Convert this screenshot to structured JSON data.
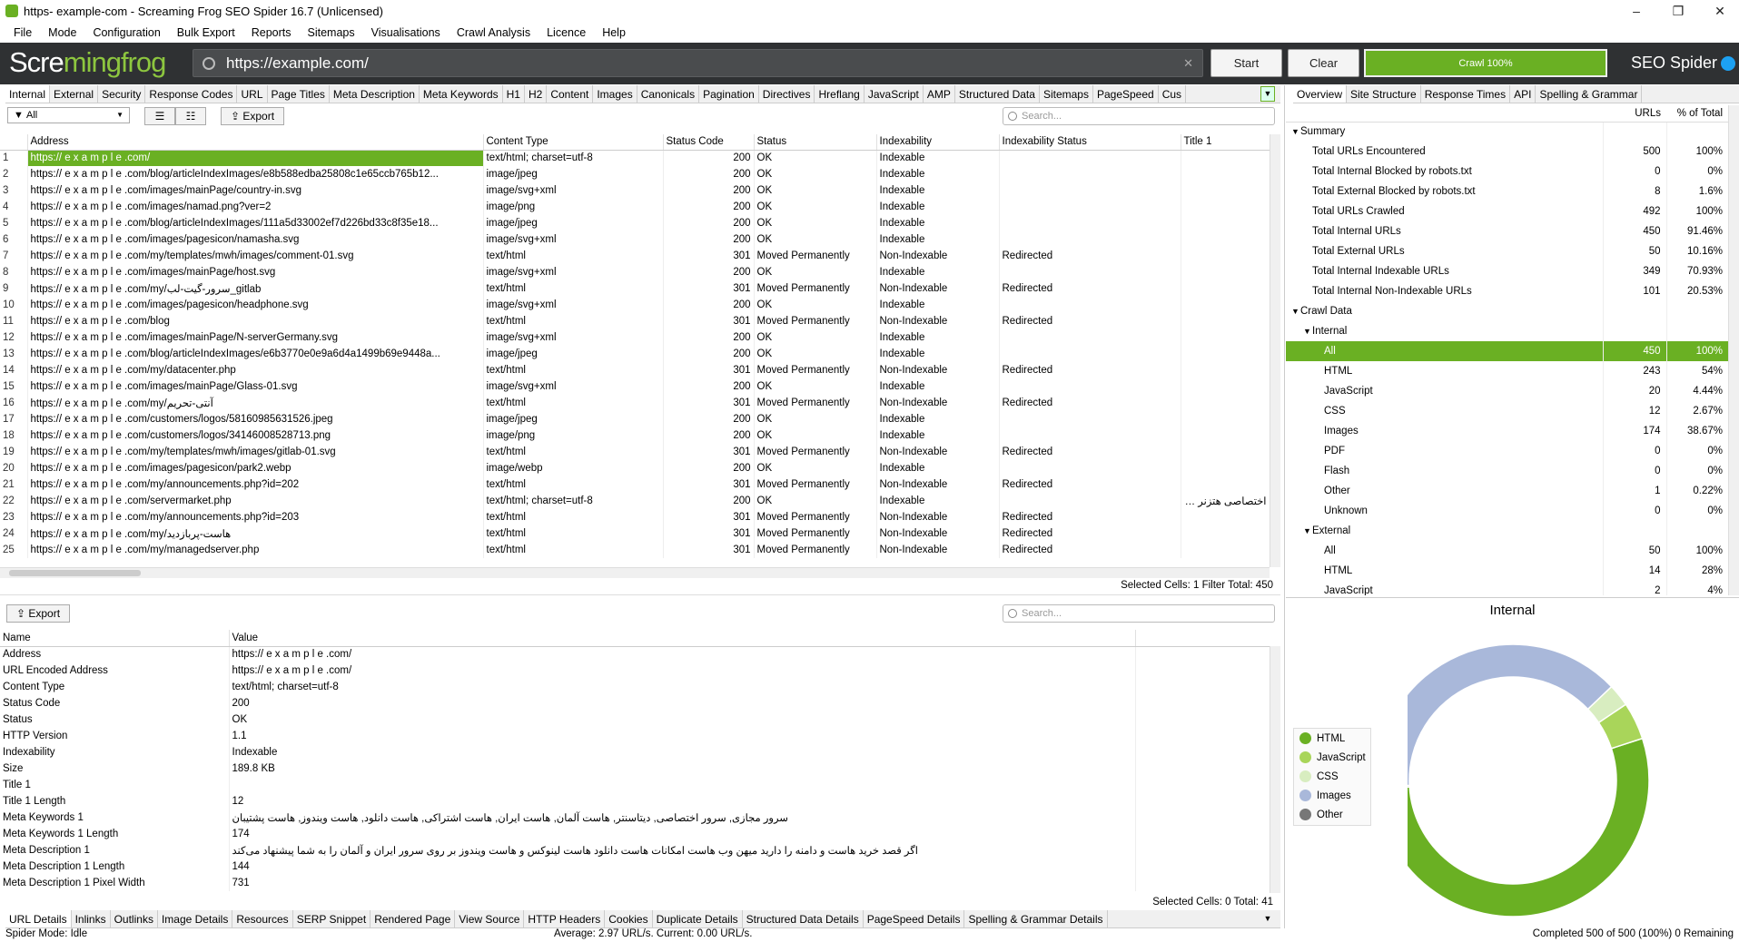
{
  "window": {
    "title": "https- example-com - Screaming Frog SEO Spider 16.7 (Unlicensed)"
  },
  "menu": [
    "File",
    "Mode",
    "Configuration",
    "Bulk Export",
    "Reports",
    "Sitemaps",
    "Visualisations",
    "Crawl Analysis",
    "Licence",
    "Help"
  ],
  "toolbar": {
    "logo_a": "Scre",
    "logo_b": "mingfrog",
    "url": "https://example.com/",
    "start": "Start",
    "clear": "Clear",
    "progress": "Crawl 100%",
    "brand": "SEO Spider"
  },
  "tabs": [
    "Internal",
    "External",
    "Security",
    "Response Codes",
    "URL",
    "Page Titles",
    "Meta Description",
    "Meta Keywords",
    "H1",
    "H2",
    "Content",
    "Images",
    "Canonicals",
    "Pagination",
    "Directives",
    "Hreflang",
    "JavaScript",
    "AMP",
    "Structured Data",
    "Sitemaps",
    "PageSpeed",
    "Cus"
  ],
  "filter": {
    "value": "All",
    "export": "Export",
    "search_placeholder": "Search..."
  },
  "columns": [
    "Address",
    "Content Type",
    "Status Code",
    "Status",
    "Indexability",
    "Indexability Status",
    "Title 1"
  ],
  "rows": [
    [
      "1",
      "https:// e x a m p l e .com/",
      "text/html; charset=utf-8",
      "200",
      "OK",
      "Indexable",
      "",
      ""
    ],
    [
      "2",
      "https:// e x a m p l e .com/blog/articleIndexImages/e8b588edba25808c1e65ccb765b12...",
      "image/jpeg",
      "200",
      "OK",
      "Indexable",
      "",
      ""
    ],
    [
      "3",
      "https:// e x a m p l e .com/images/mainPage/country-in.svg",
      "image/svg+xml",
      "200",
      "OK",
      "Indexable",
      "",
      ""
    ],
    [
      "4",
      "https:// e x a m p l e .com/images/namad.png?ver=2",
      "image/png",
      "200",
      "OK",
      "Indexable",
      "",
      ""
    ],
    [
      "5",
      "https:// e x a m p l e .com/blog/articleIndexImages/111a5d33002ef7d226bd33c8f35e18...",
      "image/jpeg",
      "200",
      "OK",
      "Indexable",
      "",
      ""
    ],
    [
      "6",
      "https:// e x a m p l e .com/images/pagesicon/namasha.svg",
      "image/svg+xml",
      "200",
      "OK",
      "Indexable",
      "",
      ""
    ],
    [
      "7",
      "https:// e x a m p l e .com/my/templates/mwh/images/comment-01.svg",
      "text/html",
      "301",
      "Moved Permanently",
      "Non-Indexable",
      "Redirected",
      ""
    ],
    [
      "8",
      "https:// e x a m p l e .com/images/mainPage/host.svg",
      "image/svg+xml",
      "200",
      "OK",
      "Indexable",
      "",
      ""
    ],
    [
      "9",
      "https:// e x a m p l e .com/my/سرور-گیت-لب_gitlab",
      "text/html",
      "301",
      "Moved Permanently",
      "Non-Indexable",
      "Redirected",
      ""
    ],
    [
      "10",
      "https:// e x a m p l e .com/images/pagesicon/headphone.svg",
      "image/svg+xml",
      "200",
      "OK",
      "Indexable",
      "",
      ""
    ],
    [
      "11",
      "https:// e x a m p l e .com/blog",
      "text/html",
      "301",
      "Moved Permanently",
      "Non-Indexable",
      "Redirected",
      ""
    ],
    [
      "12",
      "https:// e x a m p l e .com/images/mainPage/N-serverGermany.svg",
      "image/svg+xml",
      "200",
      "OK",
      "Indexable",
      "",
      ""
    ],
    [
      "13",
      "https:// e x a m p l e .com/blog/articleIndexImages/e6b3770e0e9a6d4a1499b69e9448a...",
      "image/jpeg",
      "200",
      "OK",
      "Indexable",
      "",
      ""
    ],
    [
      "14",
      "https:// e x a m p l e .com/my/datacenter.php",
      "text/html",
      "301",
      "Moved Permanently",
      "Non-Indexable",
      "Redirected",
      ""
    ],
    [
      "15",
      "https:// e x a m p l e .com/images/mainPage/Glass-01.svg",
      "image/svg+xml",
      "200",
      "OK",
      "Indexable",
      "",
      ""
    ],
    [
      "16",
      "https:// e x a m p l e .com/my/آنتی-تحریم",
      "text/html",
      "301",
      "Moved Permanently",
      "Non-Indexable",
      "Redirected",
      ""
    ],
    [
      "17",
      "https:// e x a m p l e .com/customers/logos/58160985631526.jpeg",
      "image/jpeg",
      "200",
      "OK",
      "Indexable",
      "",
      ""
    ],
    [
      "18",
      "https:// e x a m p l e .com/customers/logos/34146008528713.png",
      "image/png",
      "200",
      "OK",
      "Indexable",
      "",
      ""
    ],
    [
      "19",
      "https:// e x a m p l e .com/my/templates/mwh/images/gitlab-01.svg",
      "text/html",
      "301",
      "Moved Permanently",
      "Non-Indexable",
      "Redirected",
      ""
    ],
    [
      "20",
      "https:// e x a m p l e .com/images/pagesicon/park2.webp",
      "image/webp",
      "200",
      "OK",
      "Indexable",
      "",
      ""
    ],
    [
      "21",
      "https:// e x a m p l e .com/my/announcements.php?id=202",
      "text/html",
      "301",
      "Moved Permanently",
      "Non-Indexable",
      "Redirected",
      ""
    ],
    [
      "22",
      "https:// e x a m p l e .com/servermarket.php",
      "text/html; charset=utf-8",
      "200",
      "OK",
      "Indexable",
      "",
      "اختصاصی هتزنر آلمان"
    ],
    [
      "23",
      "https:// e x a m p l e .com/my/announcements.php?id=203",
      "text/html",
      "301",
      "Moved Permanently",
      "Non-Indexable",
      "Redirected",
      ""
    ],
    [
      "24",
      "https:// e x a m p l e .com/my/هاست-پربازدید",
      "text/html",
      "301",
      "Moved Permanently",
      "Non-Indexable",
      "Redirected",
      ""
    ],
    [
      "25",
      "https:// e x a m p l e .com/my/managedserver.php",
      "text/html",
      "301",
      "Moved Permanently",
      "Non-Indexable",
      "Redirected",
      ""
    ]
  ],
  "table_status": "Selected Cells:  1  Filter Total:  450",
  "detail": {
    "export": "Export",
    "search_placeholder": "Search...",
    "columns": [
      "Name",
      "Value"
    ],
    "rows": [
      [
        "Address",
        "https://  e x a m p l e .com/"
      ],
      [
        "URL Encoded Address",
        "https://  e x a m p l e .com/"
      ],
      [
        "Content Type",
        "text/html; charset=utf-8"
      ],
      [
        "Status Code",
        "200"
      ],
      [
        "Status",
        "OK"
      ],
      [
        "HTTP Version",
        "1.1"
      ],
      [
        "Indexability",
        "Indexable"
      ],
      [
        "Size",
        "189.8 KB"
      ],
      [
        "Title 1",
        ""
      ],
      [
        "Title 1 Length",
        "12"
      ],
      [
        "Meta Keywords 1",
        "سرور مجازی, سرور اختصاصی, دیتاسنتر, هاست آلمان, هاست ایران, هاست اشتراکی, هاست دانلود, هاست ویندوز, هاست پشتیبان"
      ],
      [
        "Meta Keywords 1 Length",
        "174"
      ],
      [
        "Meta Description 1",
        "اگر قصد خرید هاست و دامنه را دارید میهن وب هاست امکانات هاست دانلود هاست لینوکس و هاست ویندوز بر روی سرور ایران و آلمان را به شما پیشنهاد می‌کند"
      ],
      [
        "Meta Description 1 Length",
        "144"
      ],
      [
        "Meta Description 1 Pixel Width",
        "731"
      ]
    ],
    "status": "Selected Cells:  0  Total:  41"
  },
  "bottom_tabs": [
    "URL Details",
    "Inlinks",
    "Outlinks",
    "Image Details",
    "Resources",
    "SERP Snippet",
    "Rendered Page",
    "View Source",
    "HTTP Headers",
    "Cookies",
    "Duplicate Details",
    "Structured Data Details",
    "PageSpeed Details",
    "Spelling & Grammar Details"
  ],
  "statusbar": {
    "left": "Spider Mode: Idle",
    "center": "Average: 2.97 URL/s. Current: 0.00 URL/s.",
    "right": "Completed 500 of 500 (100%) 0 Remaining"
  },
  "right_tabs": [
    "Overview",
    "Site Structure",
    "Response Times",
    "API",
    "Spelling & Grammar"
  ],
  "overview": {
    "col_urls": "URLs",
    "col_pct": "% of Total",
    "rows": [
      {
        "label": "Summary",
        "level": 0,
        "toggle": "▼",
        "urls": "",
        "pct": ""
      },
      {
        "label": "Total URLs Encountered",
        "level": 1,
        "urls": "500",
        "pct": "100%"
      },
      {
        "label": "Total Internal Blocked by robots.txt",
        "level": 1,
        "urls": "0",
        "pct": "0%"
      },
      {
        "label": "Total External Blocked by robots.txt",
        "level": 1,
        "urls": "8",
        "pct": "1.6%"
      },
      {
        "label": "Total URLs Crawled",
        "level": 1,
        "urls": "492",
        "pct": "100%"
      },
      {
        "label": "Total Internal URLs",
        "level": 1,
        "urls": "450",
        "pct": "91.46%"
      },
      {
        "label": "Total External URLs",
        "level": 1,
        "urls": "50",
        "pct": "10.16%"
      },
      {
        "label": "Total Internal Indexable URLs",
        "level": 1,
        "urls": "349",
        "pct": "70.93%"
      },
      {
        "label": "Total Internal Non-Indexable URLs",
        "level": 1,
        "urls": "101",
        "pct": "20.53%"
      },
      {
        "label": "Crawl Data",
        "level": 0,
        "toggle": "▼",
        "urls": "",
        "pct": ""
      },
      {
        "label": "Internal",
        "level": 1,
        "toggle": "▼",
        "urls": "",
        "pct": ""
      },
      {
        "label": "All",
        "level": 2,
        "urls": "450",
        "pct": "100%",
        "selected": true
      },
      {
        "label": "HTML",
        "level": 2,
        "urls": "243",
        "pct": "54%"
      },
      {
        "label": "JavaScript",
        "level": 2,
        "urls": "20",
        "pct": "4.44%"
      },
      {
        "label": "CSS",
        "level": 2,
        "urls": "12",
        "pct": "2.67%"
      },
      {
        "label": "Images",
        "level": 2,
        "urls": "174",
        "pct": "38.67%"
      },
      {
        "label": "PDF",
        "level": 2,
        "urls": "0",
        "pct": "0%"
      },
      {
        "label": "Flash",
        "level": 2,
        "urls": "0",
        "pct": "0%"
      },
      {
        "label": "Other",
        "level": 2,
        "urls": "1",
        "pct": "0.22%"
      },
      {
        "label": "Unknown",
        "level": 2,
        "urls": "0",
        "pct": "0%"
      },
      {
        "label": "External",
        "level": 1,
        "toggle": "▼",
        "urls": "",
        "pct": ""
      },
      {
        "label": "All",
        "level": 2,
        "urls": "50",
        "pct": "100%"
      },
      {
        "label": "HTML",
        "level": 2,
        "urls": "14",
        "pct": "28%"
      },
      {
        "label": "JavaScript",
        "level": 2,
        "urls": "2",
        "pct": "4%"
      }
    ]
  },
  "chart_data": {
    "type": "pie",
    "title": "Internal",
    "categories": [
      "HTML",
      "JavaScript",
      "CSS",
      "Images",
      "Other"
    ],
    "values": [
      243,
      20,
      12,
      174,
      1
    ],
    "colors": [
      "#6ab023",
      "#a9d55a",
      "#d8edc0",
      "#a9b8da",
      "#777777"
    ],
    "legend_position": "left"
  }
}
